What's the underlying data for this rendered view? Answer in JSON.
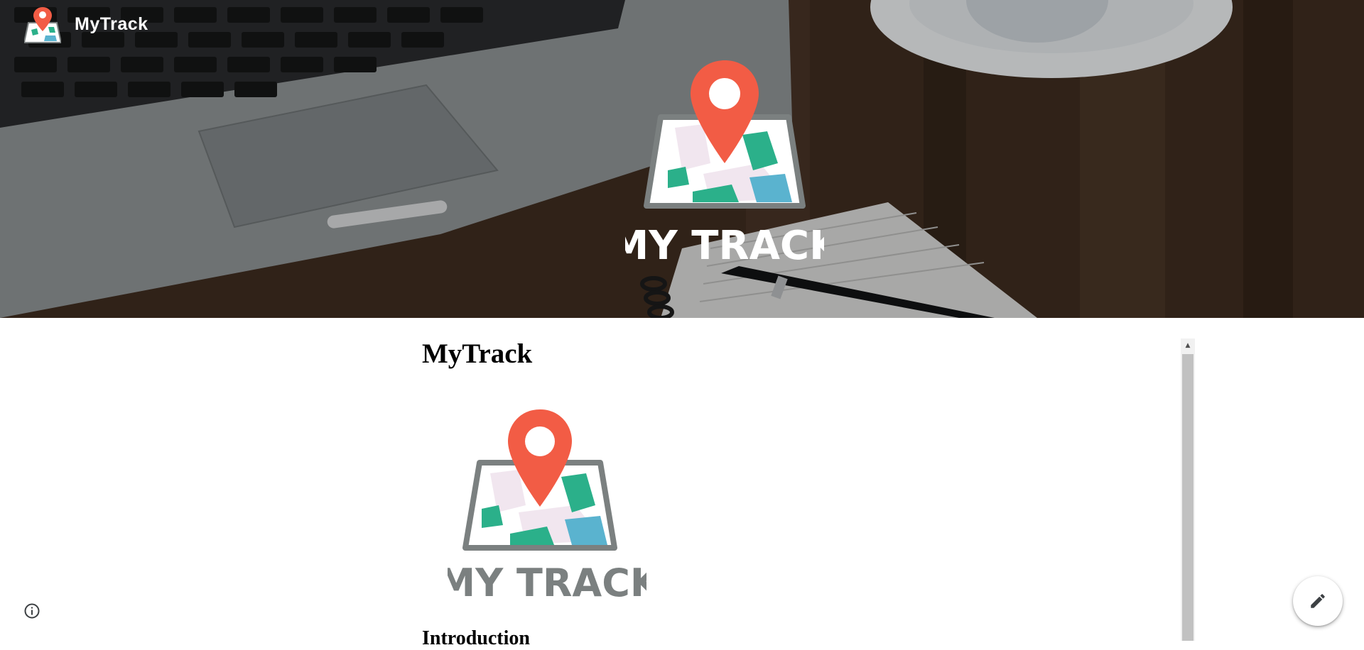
{
  "header": {
    "site_title": "MyTrack",
    "logo_icon": "map-pin-logo-icon"
  },
  "hero": {
    "logo_text": "MY TRACK",
    "background": "desk-with-laptop-coffee-notebook-photo"
  },
  "document": {
    "title": "MyTrack",
    "logo_text": "MY TRACK",
    "section_heading": "Introduction"
  },
  "controls": {
    "info_icon": "info-icon",
    "edit_icon": "pencil-icon",
    "scroll_up_glyph": "▲"
  },
  "colors": {
    "pin": "#f25c45",
    "map_green": "#2bb08a",
    "map_blue": "#5ab3cf",
    "map_frame": "#7b8080",
    "logo_text_doc": "#7b8080"
  }
}
